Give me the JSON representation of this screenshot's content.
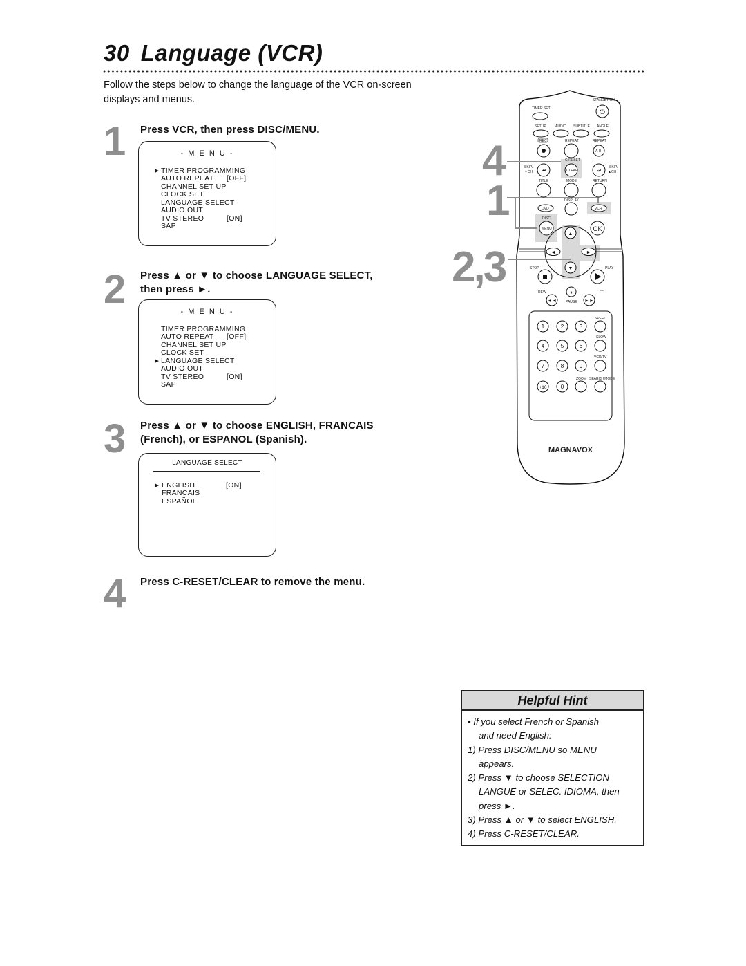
{
  "page": {
    "number": "30",
    "title": "Language (VCR)",
    "intro": "Follow the steps below to change the language of the VCR on-screen displays and menus."
  },
  "steps": [
    {
      "number": "1",
      "instruction": "Press VCR, then press DISC/MENU.",
      "screen": {
        "header": "- M E N U -",
        "items": [
          {
            "label": "TIMER PROGRAMMING",
            "value": "",
            "selected": true
          },
          {
            "label": "AUTO REPEAT",
            "value": "[OFF]",
            "selected": false
          },
          {
            "label": "CHANNEL SET UP",
            "value": "",
            "selected": false
          },
          {
            "label": "CLOCK SET",
            "value": "",
            "selected": false
          },
          {
            "label": "LANGUAGE SELECT",
            "value": "",
            "selected": false
          },
          {
            "label": "AUDIO OUT",
            "value": "",
            "selected": false
          },
          {
            "label": "TV STEREO",
            "value": "[ON]",
            "selected": false
          },
          {
            "label": "SAP",
            "value": "",
            "selected": false
          }
        ]
      }
    },
    {
      "number": "2",
      "instruction_line1": "Press ▲ or ▼ to choose LANGUAGE SELECT,",
      "instruction_line2": "then press ►.",
      "screen": {
        "header": "- M E N U -",
        "items": [
          {
            "label": "TIMER PROGRAMMING",
            "value": "",
            "selected": false
          },
          {
            "label": "AUTO REPEAT",
            "value": "[OFF]",
            "selected": false
          },
          {
            "label": "CHANNEL SET UP",
            "value": "",
            "selected": false
          },
          {
            "label": "CLOCK SET",
            "value": "",
            "selected": false
          },
          {
            "label": "LANGUAGE SELECT",
            "value": "",
            "selected": true
          },
          {
            "label": "AUDIO OUT",
            "value": "",
            "selected": false
          },
          {
            "label": "TV STEREO",
            "value": "[ON]",
            "selected": false
          },
          {
            "label": "SAP",
            "value": "",
            "selected": false
          }
        ]
      }
    },
    {
      "number": "3",
      "instruction_line1": "Press ▲ or ▼ to choose ENGLISH, FRANCAIS",
      "instruction_line2": "(French), or ESPANOL (Spanish).",
      "screen": {
        "header": "LANGUAGE SELECT",
        "items": [
          {
            "label": "ENGLISH",
            "value": "[ON]",
            "selected": true
          },
          {
            "label": "FRANCAIS",
            "value": "",
            "selected": false
          },
          {
            "label": "ESPAÑOL",
            "value": "",
            "selected": false
          }
        ]
      }
    },
    {
      "number": "4",
      "instruction": "Press C-RESET/CLEAR to remove the menu."
    }
  ],
  "pointer_glyph": "►",
  "callouts": [
    "4",
    "1",
    "2,3"
  ],
  "remote": {
    "brand": "MAGNAVOX",
    "labels": {
      "standby": "STANDBY-ON",
      "timer_set": "TIMER SET",
      "setup": "SETUP",
      "audio": "AUDIO",
      "subtitle": "SUBTITLE",
      "angle": "ANGLE",
      "rec": "REC",
      "repeat": "REPEAT",
      "repeat_ab": "REPEAT",
      "ab": "A-B",
      "c_reset": "C-RESET",
      "clear": "CLEAR",
      "skip_down": "SKIP/",
      "skip_down2": "▼CH",
      "skip_up": "SKIP/",
      "skip_up2": "▲CH",
      "title": "TITLE",
      "mode": "MODE",
      "return": "RETURN",
      "display": "DISPLAY",
      "dvd": "DVD",
      "vcr": "VCR",
      "disc": "DISC",
      "menu": "MENU",
      "ok": "OK",
      "stop": "STOP",
      "play": "PLAY",
      "rew": "REW",
      "ff": "FF",
      "pause": "PAUSE",
      "speed": "SPEED",
      "slow": "SLOW",
      "vcr_tv": "VCR/TV",
      "zoom": "ZOOM",
      "search_mode": "SEARCH MODE"
    },
    "digits": [
      "1",
      "2",
      "3",
      "4",
      "5",
      "6",
      "7",
      "8",
      "9",
      "+10",
      "0"
    ]
  },
  "hint": {
    "title": "Helpful Hint",
    "lines": [
      "•  If you select French or Spanish",
      "and need English:",
      "1) Press DISC/MENU so MENU",
      "appears.",
      "2) Press ▼ to choose SELECTION",
      "LANGUE or SELEC. IDIOMA, then",
      "press ►.",
      "3) Press ▲ or ▼ to select ENGLISH.",
      "4) Press C-RESET/CLEAR."
    ]
  }
}
